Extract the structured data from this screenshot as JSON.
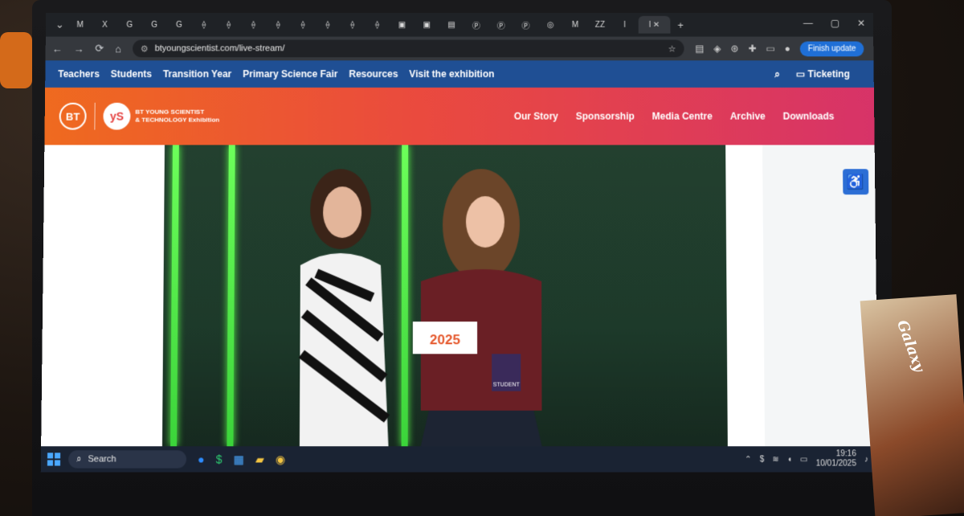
{
  "browser": {
    "tabs": [
      "M",
      "X",
      "G",
      "G",
      "G",
      "⟠",
      "⟠",
      "⟠",
      "⟠",
      "⟠",
      "⟠",
      "⟠",
      "⟠",
      "▣",
      "▣",
      "▤",
      "Ⓟ",
      "Ⓟ",
      "Ⓟ",
      "◎",
      "M",
      "ZZ",
      "l"
    ],
    "active_tab_label": "l",
    "new_tab": "+",
    "url": "btyoungscientist.com/live-stream/",
    "finish_update": "Finish update"
  },
  "site": {
    "topnav": [
      "Teachers",
      "Students",
      "Transition Year",
      "Primary Science Fair",
      "Resources",
      "Visit the exhibition"
    ],
    "ticketing": "Ticketing",
    "brand_bt": "BT",
    "brand_ys": "yS",
    "brand_text_line1": "BT YOUNG SCIENTIST",
    "brand_text_line2": "& TECHNOLOGY Exhibition",
    "mainnav": [
      "Our Story",
      "Sponsorship",
      "Media Centre",
      "Archive",
      "Downloads"
    ],
    "card_text": "2025",
    "badge_text": "STUDENT"
  },
  "taskbar": {
    "search": "Search",
    "time": "19:16",
    "date": "10/01/2025"
  },
  "desk": {
    "snack_brand": "Galaxy"
  },
  "colors": {
    "nav_blue": "#1f4f94",
    "header_orange": "#ef6a1f",
    "header_pink": "#d73368",
    "accent_green": "#5aff4a"
  }
}
